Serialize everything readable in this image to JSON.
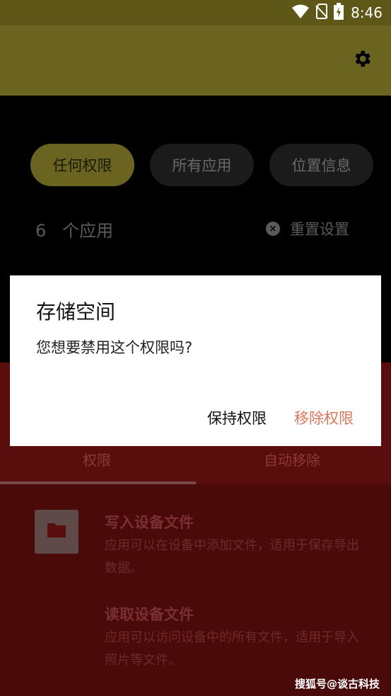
{
  "status_bar": {
    "time": "8:46",
    "icons": [
      "wifi-icon",
      "no-sim-icon",
      "battery-charging-icon"
    ]
  },
  "app_bar": {
    "settings_icon": "gear-icon"
  },
  "filters": {
    "chips": [
      {
        "label": "任何权限",
        "active": true
      },
      {
        "label": "所有应用",
        "active": false
      },
      {
        "label": "位置信息",
        "active": false
      }
    ]
  },
  "summary": {
    "count": "6",
    "count_unit": "个应用",
    "reset_label": "重置设置",
    "reset_icon": "close-circle-icon"
  },
  "tabs": [
    {
      "label": "权限"
    },
    {
      "label": "自动移除"
    }
  ],
  "permissions": [
    {
      "title": "写入设备文件",
      "desc": "应用可以在设备中添加文件，适用于保存导出数据。",
      "icon": "folder-icon"
    },
    {
      "title": "读取设备文件",
      "desc": "应用可以访问设备中的所有文件，适用于导入照片等文件。"
    }
  ],
  "dialog": {
    "title": "存储空间",
    "message": "您想要禁用这个权限吗?",
    "keep_label": "保持权限",
    "remove_label": "移除权限"
  },
  "watermark": "搜狐号@谈古科技",
  "colors": {
    "accent": "#6b6320",
    "remove_button": "#e0765a"
  }
}
